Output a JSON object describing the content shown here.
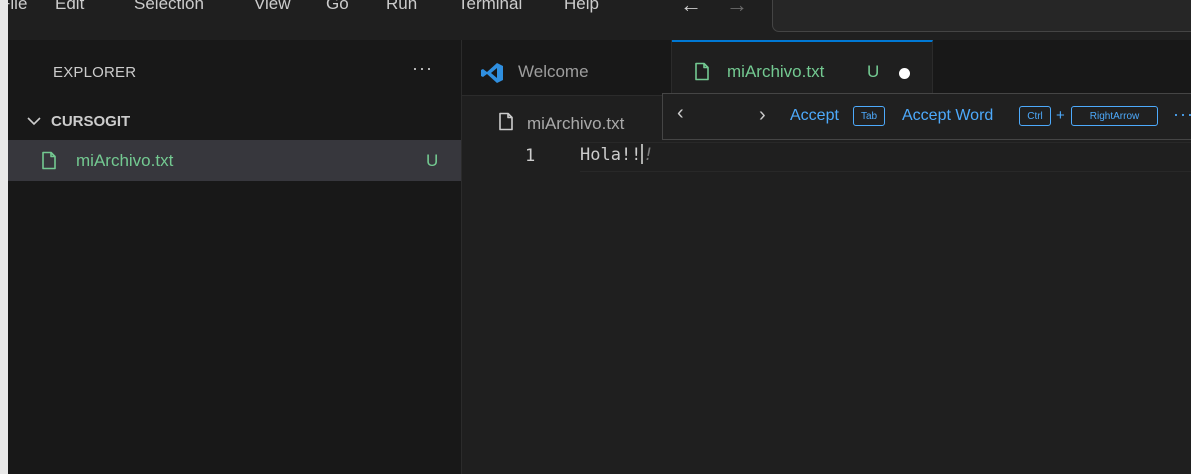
{
  "menu": {
    "items": [
      "File",
      "Edit",
      "Selection",
      "View",
      "Go",
      "Run",
      "Terminal",
      "Help"
    ]
  },
  "sidebar": {
    "title": "EXPLORER",
    "more": "···",
    "folder": "CURSOGIT",
    "file": {
      "name": "miArchivo.txt",
      "status": "U"
    }
  },
  "tabs": {
    "welcome": "Welcome",
    "file": {
      "name": "miArchivo.txt",
      "status": "U"
    }
  },
  "editor": {
    "breadcrumb": "miArchivo.txt",
    "line_number": "1",
    "code": "Hola!!",
    "ghost_text": "!"
  },
  "suggestion": {
    "accept": "Accept",
    "accept_key": "Tab",
    "accept_word": "Accept Word",
    "word_key_1": "Ctrl",
    "plus": "+",
    "word_key_2": "RightArrow",
    "more": "···"
  },
  "colors": {
    "accent": "#0078d4",
    "untracked": "#73c991",
    "link": "#4daafc"
  }
}
